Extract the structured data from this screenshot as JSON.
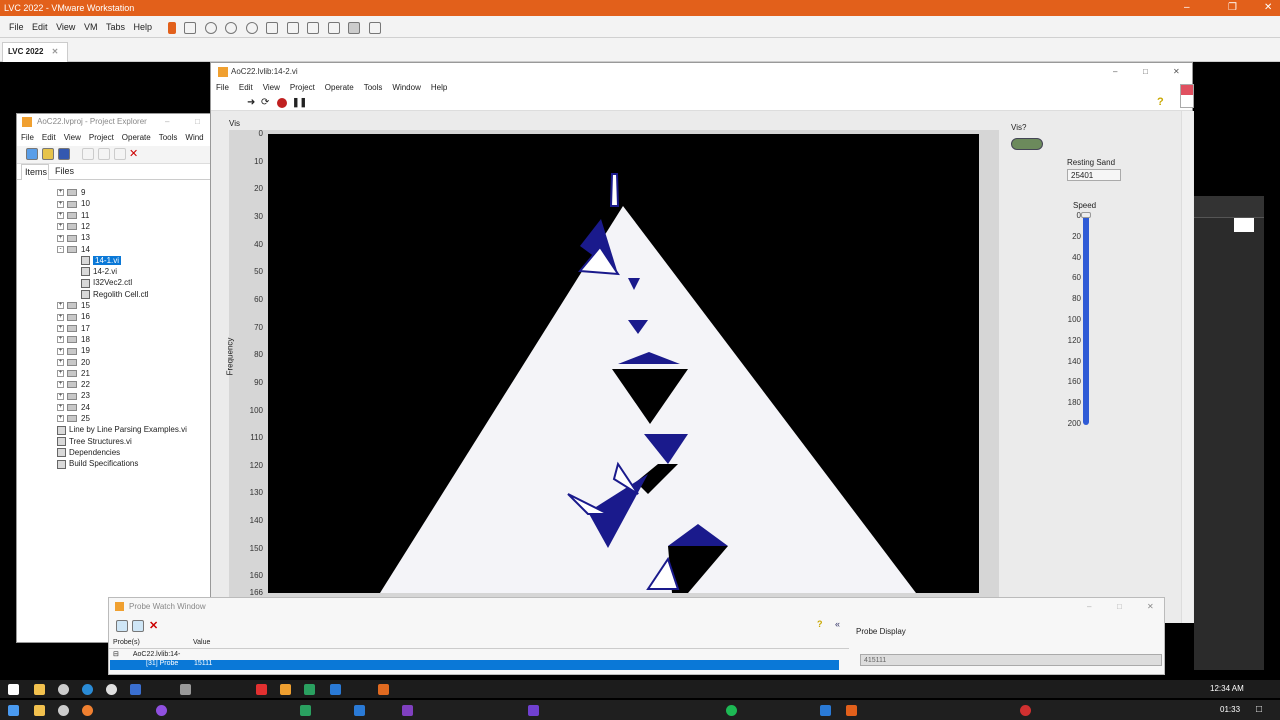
{
  "vm": {
    "title": "LVC 2022 - VMware Workstation",
    "menu": [
      "File",
      "Edit",
      "View",
      "VM",
      "Tabs",
      "Help"
    ],
    "tab": "LVC 2022"
  },
  "project": {
    "title": "AoC22.lvproj - Project Explorer",
    "menu": [
      "File",
      "Edit",
      "View",
      "Project",
      "Operate",
      "Tools",
      "Wind"
    ],
    "tabs": [
      "Items",
      "Files"
    ],
    "folders": [
      "9",
      "10",
      "11",
      "12",
      "13",
      "14"
    ],
    "children": [
      "14-1.vi",
      "14-2.vi",
      "I32Vec2.ctl",
      "Regolith Cell.ctl"
    ],
    "folders2": [
      "15",
      "16",
      "17",
      "18",
      "19",
      "20",
      "21",
      "22",
      "23",
      "24",
      "25"
    ],
    "extras": [
      "Line by Line Parsing Examples.vi",
      "Tree Structures.vi",
      "Dependencies",
      "Build Specifications"
    ]
  },
  "vi": {
    "title": "AoC22.lvlib:14-2.vi",
    "menu": [
      "File",
      "Edit",
      "View",
      "Project",
      "Operate",
      "Tools",
      "Window",
      "Help"
    ],
    "graph_label": "Vis",
    "yaxis_title": "Frequency",
    "yticks": [
      "0",
      "10",
      "20",
      "30",
      "40",
      "50",
      "60",
      "70",
      "80",
      "90",
      "100",
      "110",
      "120",
      "130",
      "140",
      "150",
      "160",
      "166"
    ],
    "vis_label": "Vis?",
    "resting_label": "Resting Sand",
    "resting_value": "25401",
    "speed_label": "Speed",
    "speed_ticks": [
      "0",
      "20",
      "40",
      "60",
      "80",
      "100",
      "120",
      "140",
      "160",
      "180",
      "200"
    ],
    "speed_level": 0
  },
  "probe": {
    "title": "Probe Watch Window",
    "col_probe": "Probe(s)",
    "col_value": "Value",
    "group": "AoC22.lvlib:14-",
    "row_probe": "[31] Probe",
    "row_value": "15111",
    "display_label": "Probe Display",
    "display_value": "415111"
  },
  "taskbar": {
    "time1": "12:34 AM",
    "time2": "01:33"
  }
}
